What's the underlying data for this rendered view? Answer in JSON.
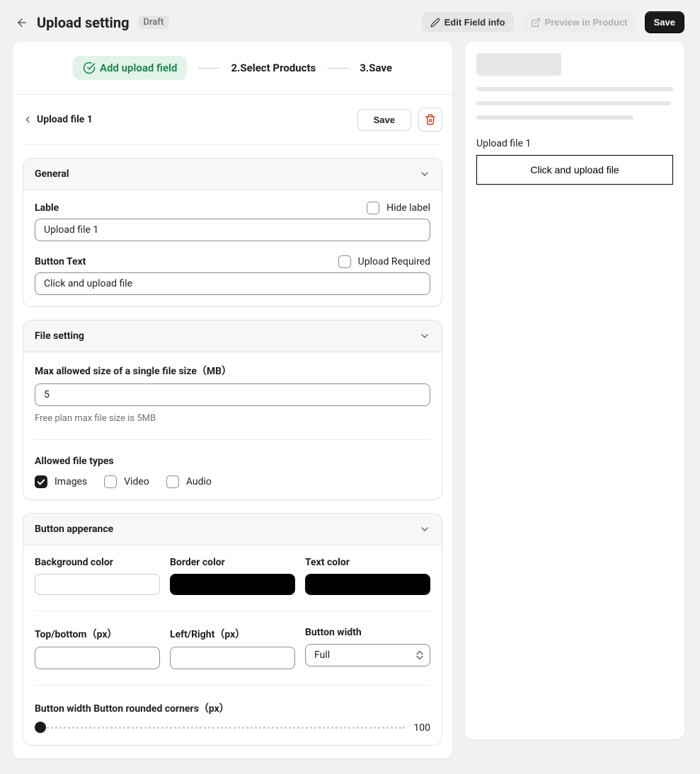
{
  "header": {
    "title": "Upload setting",
    "status_badge": "Draft",
    "edit_button": "Edit Field info",
    "preview_button": "Preview in Product",
    "save_button": "Save"
  },
  "steps": {
    "active": "Add upload field",
    "step2": "2.Select Products",
    "step3": "3.Save"
  },
  "field": {
    "name": "Upload file 1",
    "save_label": "Save"
  },
  "general": {
    "title": "General",
    "label_heading": "Lable",
    "hide_label_text": "Hide label",
    "label_value": "Upload file 1",
    "button_text_heading": "Button Text",
    "upload_required_text": "Upload Required",
    "button_text_value": "Click and upload file"
  },
  "file_setting": {
    "title": "File setting",
    "max_size_label": "Max allowed size of a single file size（MB）",
    "max_size_value": "5",
    "help_text": "Free plan max file size is 5MB",
    "allowed_types_label": "Allowed file types",
    "types": {
      "images": "Images",
      "video": "Video",
      "audio": "Audio"
    }
  },
  "appearance": {
    "title": "Button apperance",
    "bg_label": "Background color",
    "border_label": "Border color",
    "text_color_label": "Text color",
    "bg_value": "#ffffff",
    "border_value": "#000000",
    "text_value": "#000000",
    "tb_label": "Top/bottom（px）",
    "lr_label": "Left/Right（px）",
    "width_label": "Button width",
    "width_value": "Full",
    "rounded_label": "Button width Button rounded corners（px）",
    "rounded_max": "100"
  },
  "preview": {
    "label": "Upload file 1",
    "button_text": "Click and upload file"
  }
}
